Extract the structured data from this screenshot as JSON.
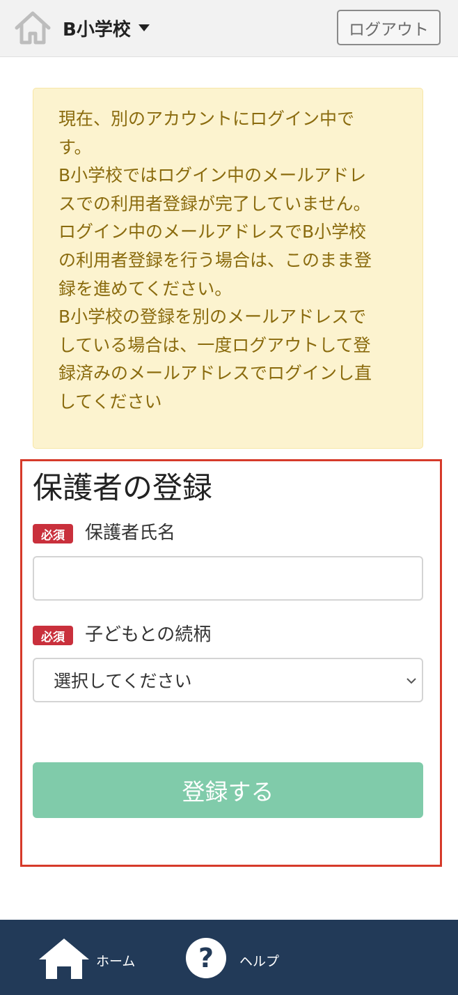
{
  "header": {
    "school_name": "B小学校",
    "logout_label": "ログアウト"
  },
  "alert": {
    "lines": [
      "現在、別のアカウントにログイン中で",
      "す。",
      "B小学校ではログイン中のメールアドレ",
      "スでの利用者登録が完了していません。",
      "ログイン中のメールアドレスでB小学校",
      "の利用者登録を行う場合は、このまま登",
      "録を進めてください。",
      "B小学校の登録を別のメールアドレスで",
      "している場合は、一度ログアウトして登",
      "録済みのメールアドレスでログインし直",
      "してください"
    ]
  },
  "form": {
    "title": "保護者の登録",
    "required_badge": "必須",
    "guardian_name_label": "保護者氏名",
    "guardian_name_value": "",
    "relationship_label": "子どもとの続柄",
    "relationship_selected": "選択してください",
    "submit_label": "登録する"
  },
  "footer": {
    "home_label": "ホーム",
    "help_label": "ヘルプ"
  },
  "colors": {
    "header_bg": "#f2f2f2",
    "alert_bg": "#fcf3cf",
    "alert_text": "#8a6b0e",
    "highlight_border": "#d63a2a",
    "badge_bg": "#c9303c",
    "submit_bg": "#80cbaa",
    "footer_bg": "#223a58"
  }
}
